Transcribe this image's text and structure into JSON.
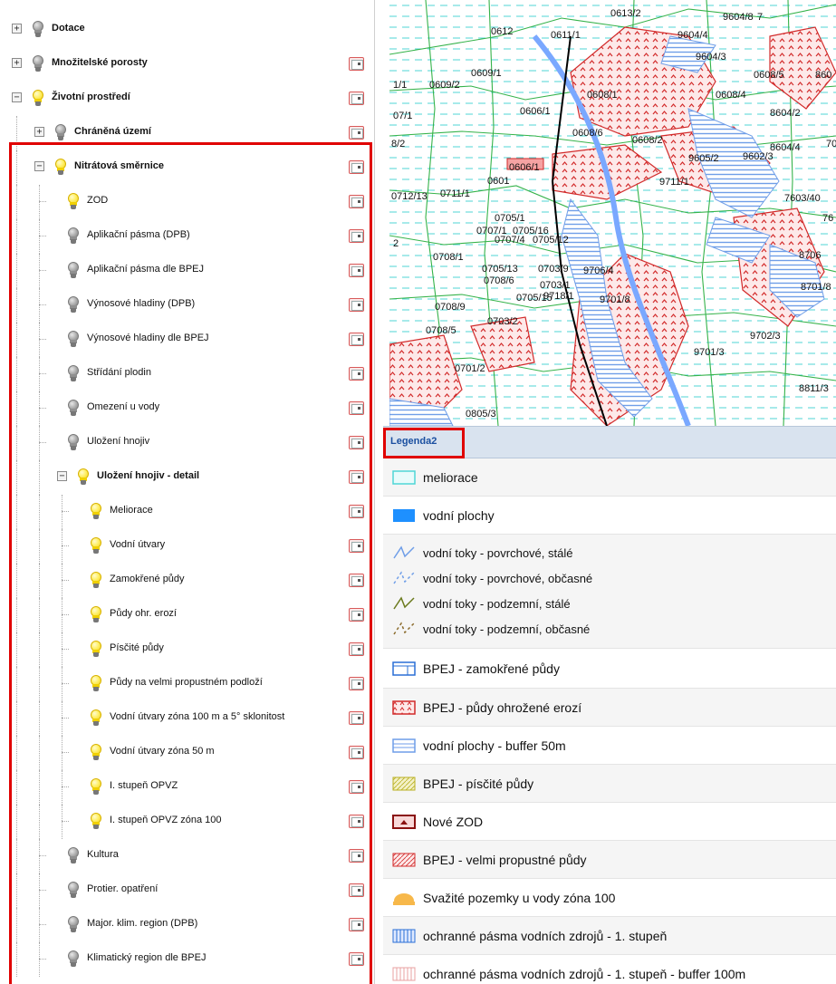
{
  "tree": {
    "items": [
      {
        "label": "Dotace",
        "level": 0,
        "bold": true,
        "state": "off",
        "expander": "+",
        "meta": false
      },
      {
        "label": "Množitelské porosty",
        "level": 0,
        "bold": true,
        "state": "off",
        "expander": "+",
        "meta": true
      },
      {
        "label": "Životní prostředí",
        "level": 0,
        "bold": true,
        "state": "on",
        "expander": "−",
        "meta": true
      },
      {
        "label": "Chráněná území",
        "level": 1,
        "bold": true,
        "state": "off",
        "expander": "+",
        "meta": true
      },
      {
        "label": "Nitrátová směrnice",
        "level": 1,
        "bold": true,
        "state": "on",
        "expander": "−",
        "meta": true
      },
      {
        "label": "ZOD",
        "level": 2,
        "bold": false,
        "state": "on",
        "expander": "",
        "meta": true
      },
      {
        "label": "Aplikační pásma (DPB)",
        "level": 2,
        "bold": false,
        "state": "off",
        "expander": "",
        "meta": true
      },
      {
        "label": "Aplikační pásma dle BPEJ",
        "level": 2,
        "bold": false,
        "state": "off",
        "expander": "",
        "meta": true
      },
      {
        "label": "Výnosové hladiny (DPB)",
        "level": 2,
        "bold": false,
        "state": "off",
        "expander": "",
        "meta": true
      },
      {
        "label": "Výnosové hladiny dle BPEJ",
        "level": 2,
        "bold": false,
        "state": "off",
        "expander": "",
        "meta": true
      },
      {
        "label": "Střídání plodin",
        "level": 2,
        "bold": false,
        "state": "off",
        "expander": "",
        "meta": true
      },
      {
        "label": "Omezení u vody",
        "level": 2,
        "bold": false,
        "state": "off",
        "expander": "",
        "meta": true
      },
      {
        "label": "Uložení hnojiv",
        "level": 2,
        "bold": false,
        "state": "off",
        "expander": "",
        "meta": true
      },
      {
        "label": "Uložení hnojiv - detail",
        "level": 2,
        "bold": true,
        "state": "on",
        "expander": "−",
        "meta": true
      },
      {
        "label": "Meliorace",
        "level": 3,
        "bold": false,
        "state": "on",
        "expander": "",
        "meta": true
      },
      {
        "label": "Vodní útvary",
        "level": 3,
        "bold": false,
        "state": "on",
        "expander": "",
        "meta": true
      },
      {
        "label": "Zamokřené půdy",
        "level": 3,
        "bold": false,
        "state": "on",
        "expander": "",
        "meta": true
      },
      {
        "label": "Půdy ohr. erozí",
        "level": 3,
        "bold": false,
        "state": "on",
        "expander": "",
        "meta": true
      },
      {
        "label": "Písčité půdy",
        "level": 3,
        "bold": false,
        "state": "on",
        "expander": "",
        "meta": true
      },
      {
        "label": "Půdy na velmi propustném podloží",
        "level": 3,
        "bold": false,
        "state": "on",
        "expander": "",
        "meta": true
      },
      {
        "label": "Vodní útvary zóna 100 m a 5° sklonitost",
        "level": 3,
        "bold": false,
        "state": "on",
        "expander": "",
        "meta": true
      },
      {
        "label": "Vodní útvary zóna 50 m",
        "level": 3,
        "bold": false,
        "state": "on",
        "expander": "",
        "meta": true
      },
      {
        "label": "I. stupeň OPVZ",
        "level": 3,
        "bold": false,
        "state": "on",
        "expander": "",
        "meta": true
      },
      {
        "label": "I. stupeň OPVZ zóna 100",
        "level": 3,
        "bold": false,
        "state": "on",
        "expander": "",
        "meta": true
      },
      {
        "label": "Kultura",
        "level": 2,
        "bold": false,
        "state": "off",
        "expander": "",
        "meta": true
      },
      {
        "label": "Protier. opatření",
        "level": 2,
        "bold": false,
        "state": "off",
        "expander": "",
        "meta": true
      },
      {
        "label": "Major. klim. region (DPB)",
        "level": 2,
        "bold": false,
        "state": "off",
        "expander": "",
        "meta": true
      },
      {
        "label": "Klimatický region dle BPEJ",
        "level": 2,
        "bold": false,
        "state": "off",
        "expander": "",
        "meta": true
      }
    ]
  },
  "map": {
    "parcel_labels": [
      "0612",
      "0611/1",
      "0613/2",
      "9604/4",
      "9604/8",
      "7",
      "9604/3",
      "0609/1",
      "0609/2",
      "1/1",
      "07/1",
      "0608/1",
      "0606/1",
      "0608/5",
      "860",
      "0608/4",
      "8604/2",
      "8/2",
      "0608/6",
      "0608/2",
      "8604/4",
      "9605/2",
      "9602/3",
      "70",
      "0606/1",
      "0601",
      "9711/1",
      "0712/13",
      "0711/1",
      "7603/40",
      "76",
      "0705/1",
      "0707/1",
      "0705/16",
      "0707/4",
      "0705/12",
      "2",
      "0708/1",
      "0705/13",
      "0708/6",
      "0703/9",
      "9706/4",
      "8706",
      "0703/1",
      "0705/15",
      "9718/1",
      "9701/8",
      "8701/8",
      "0708/9",
      "0703/2",
      "0708/5",
      "9702/3",
      "9701/3",
      "0701/2",
      "8811/3",
      "0805/3"
    ]
  },
  "legend": {
    "title": "Legenda2",
    "items": [
      {
        "label": "meliorace",
        "symbol": "meliorace-icon"
      },
      {
        "label": "vodní plochy",
        "symbol": "water-area-icon"
      },
      {
        "label": "vodní toky - povrchové, stálé",
        "symbol": "stream-surface-permanent-icon"
      },
      {
        "label": "vodní toky - povrchové, občasné",
        "symbol": "stream-surface-intermittent-icon"
      },
      {
        "label": "vodní toky - podzemní, stálé",
        "symbol": "stream-underground-permanent-icon"
      },
      {
        "label": "vodní toky - podzemní, občasné",
        "symbol": "stream-underground-intermittent-icon"
      },
      {
        "label": "BPEJ - zamokřené půdy",
        "symbol": "waterlogged-soil-icon"
      },
      {
        "label": "BPEJ - půdy ohrožené erozí",
        "symbol": "erosion-soil-icon"
      },
      {
        "label": "vodní plochy - buffer 50m",
        "symbol": "water-buffer-icon"
      },
      {
        "label": "BPEJ - písčité půdy",
        "symbol": "sandy-soil-icon"
      },
      {
        "label": "Nové ZOD",
        "symbol": "new-zod-icon"
      },
      {
        "label": "BPEJ - velmi propustné půdy",
        "symbol": "permeable-soil-icon"
      },
      {
        "label": "Svažité pozemky u vody zóna 100",
        "symbol": "slope-zone-icon"
      },
      {
        "label": "ochranné pásma vodních zdrojů - 1. stupeň",
        "symbol": "protection-zone-icon"
      },
      {
        "label": "ochranné pásma vodních zdrojů - 1. stupeň - buffer 100m",
        "symbol": "protection-zone-buffer-icon"
      }
    ]
  },
  "colors": {
    "highlight": "#e00000",
    "water": "#6f9ee8",
    "parcel": "#35b34a",
    "erosion": "#d22a2a",
    "legend_header": "#d9e3ef",
    "legend_title": "#1a4fa0"
  }
}
